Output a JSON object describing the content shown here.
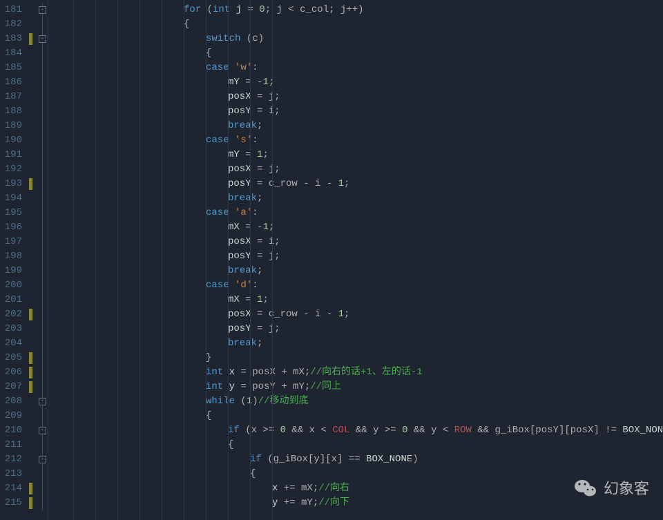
{
  "watermark": {
    "text": "幻象客"
  },
  "fold_boxes": {
    "181": "-",
    "183": "-",
    "208": "-",
    "210": "-",
    "212": "-"
  },
  "green_marks": [
    183,
    193,
    202,
    205,
    206,
    207,
    214,
    215
  ],
  "lines": [
    {
      "n": 181,
      "indent": 6,
      "tokens": [
        [
          "kw",
          "for"
        ],
        [
          "op",
          " ("
        ],
        [
          "kw",
          "int"
        ],
        [
          "id",
          " j"
        ],
        [
          "op",
          " = "
        ],
        [
          "num",
          "0"
        ],
        [
          "op",
          "; j < c_col; j++)"
        ]
      ]
    },
    {
      "n": 182,
      "indent": 6,
      "tokens": [
        [
          "op",
          "{"
        ]
      ]
    },
    {
      "n": 183,
      "indent": 7,
      "tokens": [
        [
          "kw",
          "switch"
        ],
        [
          "op",
          " (c)"
        ]
      ]
    },
    {
      "n": 184,
      "indent": 7,
      "tokens": [
        [
          "op",
          "{"
        ]
      ]
    },
    {
      "n": 185,
      "indent": 7,
      "tokens": [
        [
          "kw",
          "case"
        ],
        [
          "op",
          " "
        ],
        [
          "ch",
          "'w'"
        ],
        [
          "op",
          ":"
        ]
      ]
    },
    {
      "n": 186,
      "indent": 8,
      "tokens": [
        [
          "id",
          "mY"
        ],
        [
          "op",
          " = "
        ],
        [
          "op",
          "-"
        ],
        [
          "num",
          "1"
        ],
        [
          "op",
          ";"
        ]
      ]
    },
    {
      "n": 187,
      "indent": 8,
      "tokens": [
        [
          "id",
          "posX"
        ],
        [
          "op",
          " = j;"
        ]
      ]
    },
    {
      "n": 188,
      "indent": 8,
      "tokens": [
        [
          "id",
          "posY"
        ],
        [
          "op",
          " = i;"
        ]
      ]
    },
    {
      "n": 189,
      "indent": 8,
      "tokens": [
        [
          "kw",
          "break"
        ],
        [
          "op",
          ";"
        ]
      ]
    },
    {
      "n": 190,
      "indent": 7,
      "tokens": [
        [
          "kw",
          "case"
        ],
        [
          "op",
          " "
        ],
        [
          "ch",
          "'s'"
        ],
        [
          "op",
          ":"
        ]
      ]
    },
    {
      "n": 191,
      "indent": 8,
      "tokens": [
        [
          "id",
          "mY"
        ],
        [
          "op",
          " = "
        ],
        [
          "num",
          "1"
        ],
        [
          "op",
          ";"
        ]
      ]
    },
    {
      "n": 192,
      "indent": 8,
      "tokens": [
        [
          "id",
          "posX"
        ],
        [
          "op",
          " = j;"
        ]
      ]
    },
    {
      "n": 193,
      "indent": 8,
      "tokens": [
        [
          "id",
          "posY"
        ],
        [
          "op",
          " = c_row - i - "
        ],
        [
          "num",
          "1"
        ],
        [
          "op",
          ";"
        ]
      ]
    },
    {
      "n": 194,
      "indent": 8,
      "tokens": [
        [
          "kw",
          "break"
        ],
        [
          "op",
          ";"
        ]
      ]
    },
    {
      "n": 195,
      "indent": 7,
      "tokens": [
        [
          "kw",
          "case"
        ],
        [
          "op",
          " "
        ],
        [
          "ch",
          "'a'"
        ],
        [
          "op",
          ":"
        ]
      ]
    },
    {
      "n": 196,
      "indent": 8,
      "tokens": [
        [
          "id",
          "mX"
        ],
        [
          "op",
          " = "
        ],
        [
          "op",
          "-"
        ],
        [
          "num",
          "1"
        ],
        [
          "op",
          ";"
        ]
      ]
    },
    {
      "n": 197,
      "indent": 8,
      "tokens": [
        [
          "id",
          "posX"
        ],
        [
          "op",
          " = i;"
        ]
      ]
    },
    {
      "n": 198,
      "indent": 8,
      "tokens": [
        [
          "id",
          "posY"
        ],
        [
          "op",
          " = j;"
        ]
      ]
    },
    {
      "n": 199,
      "indent": 8,
      "tokens": [
        [
          "kw",
          "break"
        ],
        [
          "op",
          ";"
        ]
      ]
    },
    {
      "n": 200,
      "indent": 7,
      "tokens": [
        [
          "kw",
          "case"
        ],
        [
          "op",
          " "
        ],
        [
          "ch",
          "'d'"
        ],
        [
          "op",
          ":"
        ]
      ]
    },
    {
      "n": 201,
      "indent": 8,
      "tokens": [
        [
          "id",
          "mX"
        ],
        [
          "op",
          " = "
        ],
        [
          "num",
          "1"
        ],
        [
          "op",
          ";"
        ]
      ]
    },
    {
      "n": 202,
      "indent": 8,
      "tokens": [
        [
          "id",
          "posX"
        ],
        [
          "op",
          " = c_row - i - "
        ],
        [
          "num",
          "1"
        ],
        [
          "op",
          ";"
        ]
      ]
    },
    {
      "n": 203,
      "indent": 8,
      "tokens": [
        [
          "id",
          "posY"
        ],
        [
          "op",
          " = j;"
        ]
      ]
    },
    {
      "n": 204,
      "indent": 8,
      "tokens": [
        [
          "kw",
          "break"
        ],
        [
          "op",
          ";"
        ]
      ]
    },
    {
      "n": 205,
      "indent": 7,
      "tokens": [
        [
          "op",
          "}"
        ]
      ]
    },
    {
      "n": 206,
      "indent": 7,
      "tokens": [
        [
          "kw",
          "int"
        ],
        [
          "id",
          " x"
        ],
        [
          "op",
          " = posX + mX;"
        ],
        [
          "cmt",
          "//向右的话+1、左的话-1"
        ]
      ]
    },
    {
      "n": 207,
      "indent": 7,
      "tokens": [
        [
          "kw",
          "int"
        ],
        [
          "id",
          " y"
        ],
        [
          "op",
          " = posY + mY;"
        ],
        [
          "cmt",
          "//同上"
        ]
      ]
    },
    {
      "n": 208,
      "indent": 7,
      "tokens": [
        [
          "kw",
          "while"
        ],
        [
          "op",
          " ("
        ],
        [
          "num",
          "1"
        ],
        [
          "op",
          ")"
        ],
        [
          "cmt",
          "//移动到底"
        ]
      ]
    },
    {
      "n": 209,
      "indent": 7,
      "tokens": [
        [
          "op",
          "{"
        ]
      ]
    },
    {
      "n": 210,
      "indent": 8,
      "tokens": [
        [
          "kw",
          "if"
        ],
        [
          "op",
          " (x >= "
        ],
        [
          "num",
          "0"
        ],
        [
          "op",
          " && x < "
        ],
        [
          "idc",
          "COL"
        ],
        [
          "op",
          " && y >= "
        ],
        [
          "num",
          "0"
        ],
        [
          "op",
          " && y < "
        ],
        [
          "idc",
          "ROW"
        ],
        [
          "op",
          " && g_iBox[posY][posX] != "
        ],
        [
          "id",
          "BOX_NONE"
        ],
        [
          "op",
          ")"
        ]
      ]
    },
    {
      "n": 211,
      "indent": 8,
      "tokens": [
        [
          "op",
          "{"
        ]
      ]
    },
    {
      "n": 212,
      "indent": 9,
      "tokens": [
        [
          "kw",
          "if"
        ],
        [
          "op",
          " (g_iBox[y][x] == "
        ],
        [
          "id",
          "BOX_NONE"
        ],
        [
          "op",
          ")"
        ]
      ]
    },
    {
      "n": 213,
      "indent": 9,
      "tokens": [
        [
          "op",
          "{"
        ]
      ]
    },
    {
      "n": 214,
      "indent": 10,
      "tokens": [
        [
          "id",
          "x"
        ],
        [
          "op",
          " += mX;"
        ],
        [
          "cmt",
          "//向右"
        ]
      ]
    },
    {
      "n": 215,
      "indent": 10,
      "tokens": [
        [
          "id",
          "y"
        ],
        [
          "op",
          " += mY;"
        ],
        [
          "cmt",
          "//向下"
        ]
      ]
    }
  ]
}
